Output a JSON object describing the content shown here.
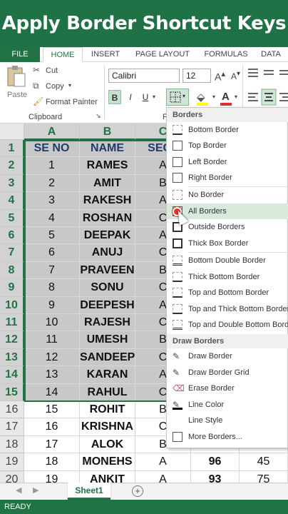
{
  "banner": {
    "title": "Apply Border Shortcut Keys"
  },
  "tabs": [
    "FILE",
    "HOME",
    "INSERT",
    "PAGE LAYOUT",
    "FORMULAS",
    "DATA"
  ],
  "active_tab": "HOME",
  "clipboard": {
    "paste": "Paste",
    "cut": "Cut",
    "copy": "Copy",
    "format_painter": "Format Painter",
    "group": "Clipboard"
  },
  "font": {
    "name": "Calibri",
    "size": "12",
    "group_initial": "F",
    "bold": "B",
    "italic": "I",
    "underline": "U"
  },
  "columns": [
    "A",
    "B",
    "C"
  ],
  "rows": [
    {
      "n": "1",
      "a": "SE NO",
      "b": "NAME",
      "c": "SECT"
    },
    {
      "n": "2",
      "a": "1",
      "b": "RAMES",
      "c": "A"
    },
    {
      "n": "3",
      "a": "2",
      "b": "AMIT",
      "c": "B"
    },
    {
      "n": "4",
      "a": "3",
      "b": "RAKESH",
      "c": "A"
    },
    {
      "n": "5",
      "a": "4",
      "b": "ROSHAN",
      "c": "C"
    },
    {
      "n": "6",
      "a": "5",
      "b": "DEEPAK",
      "c": "A"
    },
    {
      "n": "7",
      "a": "6",
      "b": "ANUJ",
      "c": "C"
    },
    {
      "n": "8",
      "a": "7",
      "b": "PRAVEEN",
      "c": "B"
    },
    {
      "n": "9",
      "a": "8",
      "b": "SONU",
      "c": "C"
    },
    {
      "n": "10",
      "a": "9",
      "b": "DEEPESH",
      "c": "A"
    },
    {
      "n": "11",
      "a": "10",
      "b": "RAJESH",
      "c": "C"
    },
    {
      "n": "12",
      "a": "11",
      "b": "UMESH",
      "c": "B"
    },
    {
      "n": "13",
      "a": "12",
      "b": "SANDEEP",
      "c": "C"
    },
    {
      "n": "14",
      "a": "13",
      "b": "KARAN",
      "c": "A"
    },
    {
      "n": "15",
      "a": "14",
      "b": "RAHUL",
      "c": "C"
    },
    {
      "n": "16",
      "a": "15",
      "b": "ROHIT",
      "c": "B"
    },
    {
      "n": "17",
      "a": "16",
      "b": "KRISHNA",
      "c": "C"
    },
    {
      "n": "18",
      "a": "17",
      "b": "ALOK",
      "c": "B",
      "d": "90",
      "e": "15"
    },
    {
      "n": "19",
      "a": "18",
      "b": "MONEHS",
      "c": "A",
      "d": "96",
      "e": "45"
    },
    {
      "n": "20",
      "a": "19",
      "b": "ANKIT",
      "c": "A",
      "d": "93",
      "e": "75"
    }
  ],
  "borders_menu": {
    "header": "Borders",
    "items": [
      "Bottom Border",
      "Top Border",
      "Left Border",
      "Right Border",
      "No Border",
      "All Borders",
      "Outside Borders",
      "Thick Box Border",
      "Bottom Double Border",
      "Thick Bottom Border",
      "Top and Bottom Border",
      "Top and Thick Bottom Border",
      "Top and Double Bottom Border"
    ],
    "draw_header": "Draw Borders",
    "draw_items": [
      "Draw Border",
      "Draw Border Grid",
      "Erase Border",
      "Line Color",
      "Line Style",
      "More Borders..."
    ],
    "highlighted": "All Borders"
  },
  "sheet": {
    "tab": "Sheet1",
    "add": "+"
  },
  "status": {
    "text": "READY"
  },
  "colors": {
    "excel_green": "#217346",
    "banner_green": "#1e7245",
    "selection_gray": "#c8c8c8",
    "header_blue": "#1f3b6d"
  }
}
